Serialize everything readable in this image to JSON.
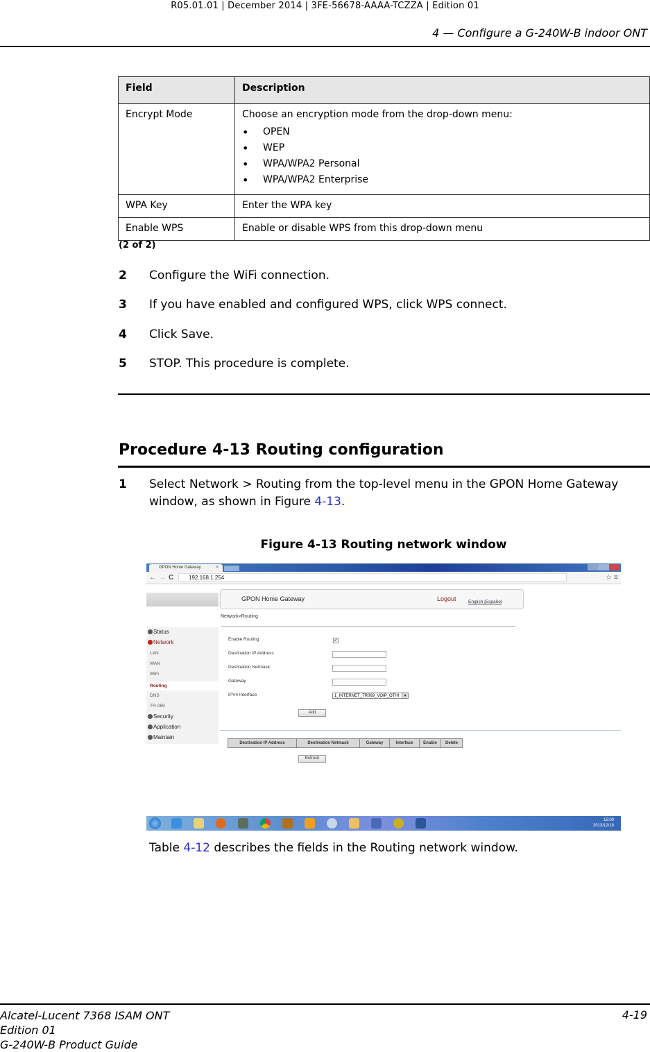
{
  "header": {
    "doc_ref": "R05.01.01 | December 2014 | 3FE-56678-AAAA-TCZZA | Edition 01",
    "chapter": "4 —  Configure a G-240W-B indoor ONT"
  },
  "field_table": {
    "columns": [
      "Field",
      "Description"
    ],
    "rows": [
      {
        "field": "Encrypt Mode",
        "description": "Choose an encryption mode from the drop-down menu:",
        "options": [
          "OPEN",
          "WEP",
          "WPA/WPA2 Personal",
          "WPA/WPA2 Enterprise"
        ]
      },
      {
        "field": "WPA Key",
        "description": "Enter the WPA key"
      },
      {
        "field": "Enable WPS",
        "description": "Enable or disable WPS from this drop-down menu"
      }
    ],
    "note": "(2 of 2)"
  },
  "steps_prev": [
    {
      "num": "2",
      "text": "Configure the WiFi connection."
    },
    {
      "num": "3",
      "text": "If you have enabled and configured WPS, click WPS connect."
    },
    {
      "num": "4",
      "text": "Click Save."
    },
    {
      "num": "5",
      "text": "STOP. This procedure is complete."
    }
  ],
  "procedure": {
    "title": "Procedure 4-13  Routing configuration",
    "step1": {
      "num": "1",
      "line1": "Select Network > Routing from the top-level menu in the GPON Home Gateway",
      "line2_pre": "window, as shown in Figure ",
      "line2_link": "4-13",
      "line2_post": "."
    },
    "figure_caption": "Figure 4-13  Routing network window",
    "after_pre": "Table ",
    "after_link": "4-12",
    "after_post": " describes the fields in the Routing network window."
  },
  "screenshot": {
    "tab_title": "GPON Home Gateway",
    "tab_close": "×",
    "url": "192.168.1.254",
    "gateway_title": "GPON Home Gateway",
    "logout": "Logout",
    "lang": "English |Español",
    "breadcrumb": "Network>Routing",
    "sidebar": {
      "status": "Status",
      "network": "Network",
      "lan": "LAN",
      "wan": "WAN",
      "wifi": "WiFi",
      "routing": "Routing",
      "dns": "DNS",
      "tr069": "TR-069",
      "security": "Security",
      "application": "Application",
      "maintain": "Maintain"
    },
    "form": {
      "enable_routing": "Enable Routing",
      "enable_routing_checked": "✓",
      "dest_ip": "Destination IP Address",
      "dest_ip_value": "",
      "dest_mask": "Destination Netmask",
      "dest_mask_value": "",
      "gateway": "Gateway",
      "gateway_value": "",
      "ipv4_if": "IPV4 Interface",
      "ipv4_if_value": "1_INTERNET_TR069_VOIP_OTHI",
      "add": "Add"
    },
    "route_table": {
      "columns": [
        "Destination IP Address",
        "Destination Netmask",
        "Gateway",
        "Interface",
        "Enable",
        "Delete"
      ]
    },
    "refresh": "Refresh",
    "clock_time": "15:09",
    "clock_date": "2013/12/18"
  },
  "footer": {
    "line1": "Alcatel-Lucent 7368 ISAM ONT",
    "line2": "Edition 01",
    "line3": "G-240W-B Product Guide",
    "page": "4-19"
  }
}
